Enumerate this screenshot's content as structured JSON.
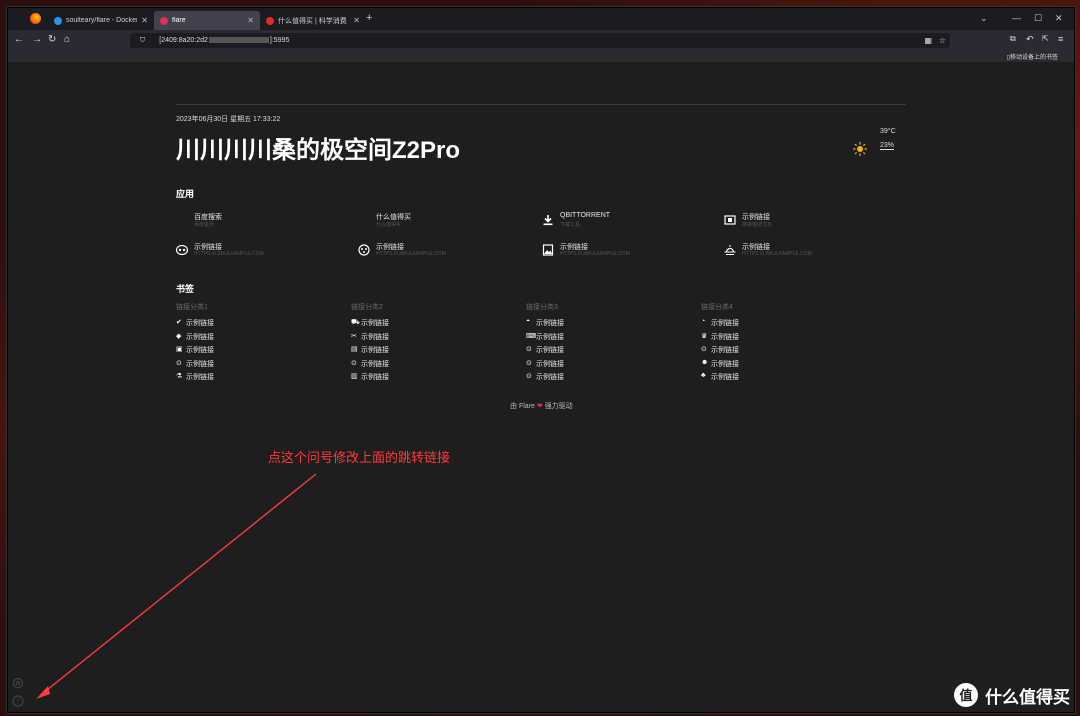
{
  "browser": {
    "tabs": [
      {
        "title": "soulteary/flare - Docker Ima",
        "active": false,
        "icon_color": "#2496ed"
      },
      {
        "title": "flare",
        "active": true,
        "icon_color": "#e0334c"
      },
      {
        "title": "什么值得买 | 科学消费 认真生活",
        "active": false,
        "icon_color": "#e62828"
      }
    ],
    "url_prefix": "[2409:8a20:2d2",
    "url_suffix": "]:5995",
    "mobile_bookmarks": "移动设备上的书签"
  },
  "page": {
    "datetime": "2023年06月30日 星期五 17:33:22",
    "title": "川川川川桑的极空间Z2Pro",
    "weather": {
      "temperature": "39°C",
      "humidity": "23%"
    },
    "apps_title": "应用",
    "apps": [
      {
        "name": "百度搜索",
        "desc": "百度首页",
        "icon": "none"
      },
      {
        "name": "什么值得买",
        "desc": "什么值得买",
        "icon": "none"
      },
      {
        "name": "QBITTORRENT",
        "desc": "下载工具",
        "icon": "download-icon"
      },
      {
        "name": "示例链接",
        "desc": "链接描述文本",
        "icon": "cube-icon"
      },
      {
        "name": "示例链接",
        "desc": "HTTPS://LINK.EXAMPLE.COM",
        "icon": "mask-icon"
      },
      {
        "name": "示例链接",
        "desc": "HTTPS://LINK.EXAMPLE.COM",
        "icon": "face-icon"
      },
      {
        "name": "示例链接",
        "desc": "HTTPS://LINK.EXAMPLE.COM",
        "icon": "image-icon"
      },
      {
        "name": "示例链接",
        "desc": "HTTPS://LINK.EXAMPLE.COM",
        "icon": "sunset-icon"
      }
    ],
    "bookmarks_title": "书签",
    "categories": [
      {
        "title": "链接分类1",
        "links": [
          {
            "text": "示例链接",
            "icon": "check-badge-icon"
          },
          {
            "text": "示例链接",
            "icon": "eraser-icon"
          },
          {
            "text": "示例链接",
            "icon": "mastodon-icon"
          },
          {
            "text": "示例链接",
            "icon": "coin-icon"
          },
          {
            "text": "示例链接",
            "icon": "flask-icon"
          }
        ]
      },
      {
        "title": "链接分类2",
        "links": [
          {
            "text": "示例链接",
            "icon": "car-icon"
          },
          {
            "text": "示例链接",
            "icon": "tools-icon"
          },
          {
            "text": "示例链接",
            "icon": "chat-icon"
          },
          {
            "text": "示例链接",
            "icon": "coin-icon"
          },
          {
            "text": "示例链接",
            "icon": "chart-icon"
          }
        ]
      },
      {
        "title": "链接分类3",
        "links": [
          {
            "text": "示例链接",
            "icon": "gamepad-icon"
          },
          {
            "text": "示例链接",
            "icon": "keyboard-icon"
          },
          {
            "text": "示例链接",
            "icon": "coin-icon"
          },
          {
            "text": "示例链接",
            "icon": "coin-icon"
          },
          {
            "text": "示例链接",
            "icon": "coin-icon"
          }
        ]
      },
      {
        "title": "链接分类4",
        "links": [
          {
            "text": "示例链接",
            "icon": "compass-icon"
          },
          {
            "text": "示例链接",
            "icon": "spy-icon"
          },
          {
            "text": "示例链接",
            "icon": "coin-icon"
          },
          {
            "text": "示例链接",
            "icon": "smile-icon"
          },
          {
            "text": "示例链接",
            "icon": "seedling-icon"
          }
        ]
      }
    ],
    "footer": {
      "prefix": "由 Flare",
      "heart": "❤",
      "suffix": "强力驱动"
    }
  },
  "annotation": "点这个问号修改上面的跳转链接",
  "watermark": {
    "text": "什么值得买",
    "logo": "值"
  },
  "colors": {
    "accent": "#e0334c",
    "annotation": "#ff3b3b",
    "page_bg": "#1e1e1e"
  }
}
